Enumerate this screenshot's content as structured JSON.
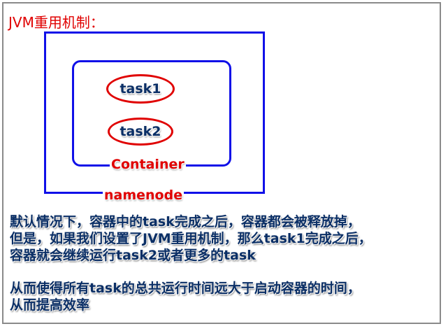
{
  "title": "JVM重用机制：",
  "diagram": {
    "outer_label": "namenode",
    "inner_label": "Container",
    "tasks": [
      "task1",
      "task2"
    ]
  },
  "paragraph1": {
    "lines": [
      "默认情况下，容器中的task完成之后，容器都会被释放掉，",
      "但是，如果我们设置了JVM重用机制，那么task1完成之后，",
      "容器就会继续运行task2或者更多的task"
    ]
  },
  "paragraph2": {
    "lines": [
      "从而使得所有task的总共运行时间远大于启动容器的时间，",
      "从而提高效率"
    ]
  },
  "colors": {
    "title": "#e00000",
    "box_border": "#1010e8",
    "oval_border": "#e00000",
    "body_text": "#0b2f66",
    "frame": "#8a8a8a"
  }
}
